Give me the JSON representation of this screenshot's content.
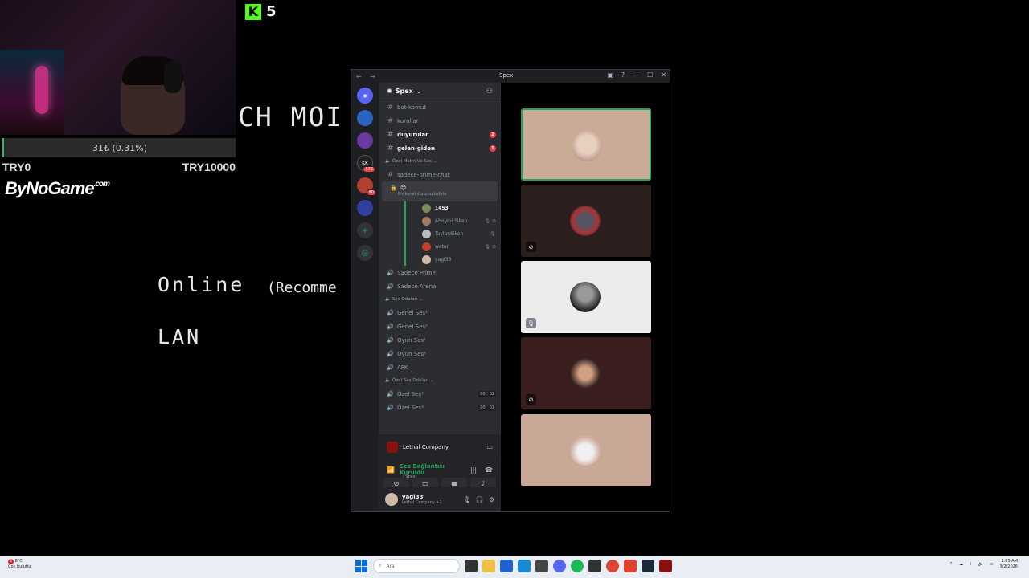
{
  "overlay": {
    "kick_count": "5",
    "donation_text": "31₺ (0.31%)",
    "goal_min": "TRY0",
    "goal_max": "TRY10000",
    "brand": "ByNoGame",
    "brand_suffix": ".com",
    "game_title_fragment": "CH MOI",
    "menu_online": "Online",
    "menu_recommended_fragment": "(Recomme",
    "menu_lan": "LAN"
  },
  "discord": {
    "window_title": "Spex",
    "server_name": "Spex",
    "guild_badges": [
      "572",
      "90"
    ],
    "guild_label_kk": "KK",
    "channels_top": [
      {
        "name": "bot-komut",
        "unread": false,
        "mention": ""
      },
      {
        "name": "kurallar",
        "unread": false,
        "mention": ""
      },
      {
        "name": "duyurular",
        "unread": true,
        "mention": "2"
      },
      {
        "name": "gelen-giden",
        "unread": true,
        "mention": "1"
      }
    ],
    "category_private": "Özel Metin Ve Ses",
    "private_text_channel": "sadece-prime-chat",
    "active_voice_status": "Bir kanal durumu belirle",
    "voice_members": [
      {
        "name": "1453",
        "speaking": true
      },
      {
        "name": "Ahoyini Siken",
        "speaking": false
      },
      {
        "name": "TaylanSiken",
        "speaking": false
      },
      {
        "name": "water",
        "speaking": false
      },
      {
        "name": "yagi33",
        "speaking": false
      }
    ],
    "private_voice_channels": [
      "Sadece Prime",
      "Sadece Arena"
    ],
    "category_voice": "Ses Odaları",
    "voice_channels": [
      "Genel Ses¹",
      "Genel Ses²",
      "Oyun Ses¹",
      "Oyun Ses²",
      "AFK"
    ],
    "category_private_voice": "Özel Ses Odaları",
    "private_rooms": [
      {
        "name": "Özel Ses¹",
        "limit_a": "00",
        "limit_b": "02"
      },
      {
        "name": "Özel Ses²",
        "limit_a": "00",
        "limit_b": "02"
      }
    ],
    "activity_game": "Lethal Company",
    "voice_connected": "Ses Bağlantısı Kuruldu",
    "voice_location": "/ Spex",
    "user_name": "yagi33",
    "user_status": "Lethal Company +1"
  },
  "taskbar": {
    "weather_temp": "8°C",
    "weather_desc": "Çok bulutlu",
    "weather_badge": "2",
    "search_placeholder": "Ara",
    "time": "1:05 AM",
    "date": "3/2/2026"
  },
  "colors": {
    "discord_green": "#23a55a",
    "mention_red": "#f23f43",
    "kick_green": "#53fc18",
    "blurple": "#5865f2"
  }
}
